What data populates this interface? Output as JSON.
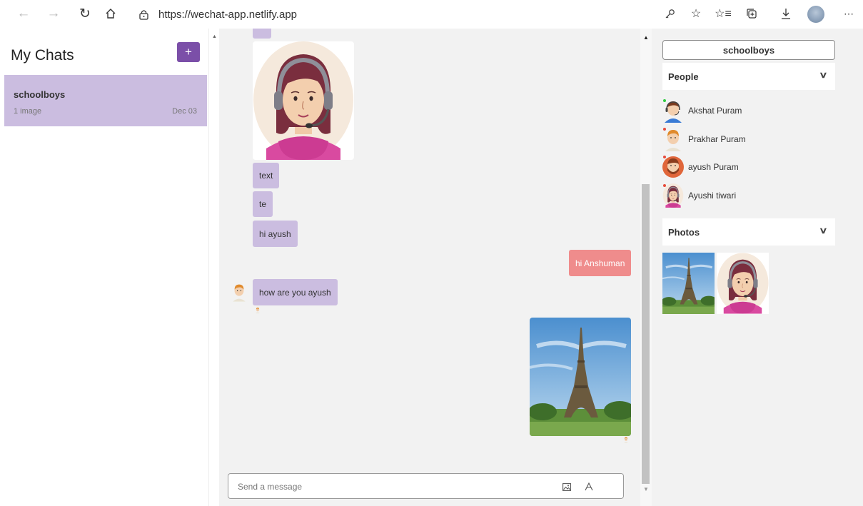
{
  "browser": {
    "url": "https://wechat-app.netlify.app"
  },
  "sidebar": {
    "title": "My Chats",
    "add_button_label": "+",
    "chats": [
      {
        "name": "schoolboys",
        "preview": "1 image",
        "date": "Dec 03"
      }
    ]
  },
  "messages": [
    {
      "text": "text"
    },
    {
      "text": "te"
    },
    {
      "text": "hi ayush"
    },
    {
      "text": "hi Anshuman"
    },
    {
      "text": "how are you ayush"
    }
  ],
  "composer": {
    "placeholder": "Send a message"
  },
  "details": {
    "group_name": "schoolboys",
    "people_label": "People",
    "people": [
      {
        "name": "Akshat Puram",
        "status_color": "#2ecc40"
      },
      {
        "name": "Prakhar Puram",
        "status_color": "#e74c3c"
      },
      {
        "name": "ayush Puram",
        "status_color": "#e74c3c"
      },
      {
        "name": "Ayushi tiwari",
        "status_color": "#e74c3c"
      }
    ],
    "photos_label": "Photos"
  },
  "colors": {
    "accent": "#7b4fa8",
    "received_bubble": "#cbbde0",
    "sent_bubble": "#ef8c8c"
  }
}
